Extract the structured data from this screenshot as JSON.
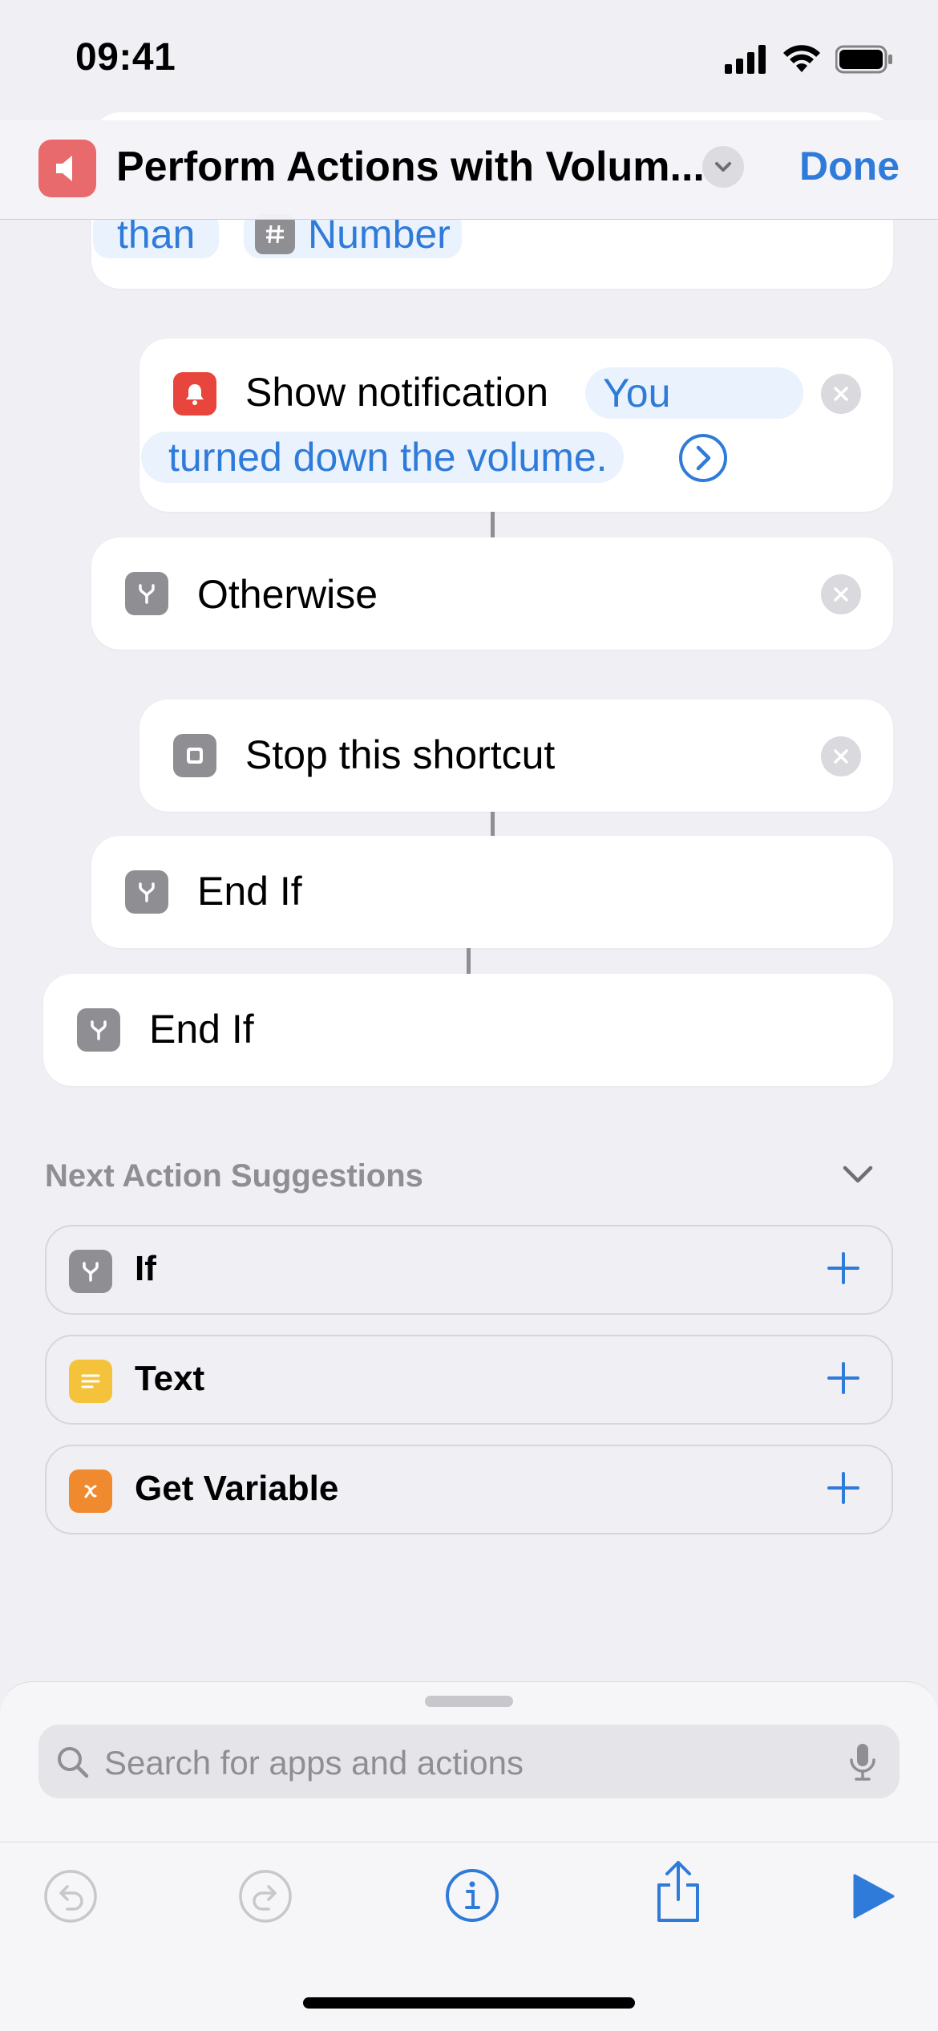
{
  "status_bar": {
    "time": "09:41"
  },
  "navbar": {
    "title": "Perform Actions with Volum...",
    "done_label": "Done",
    "app_icon": "speaker-icon",
    "accent_color": "#2f7bd9",
    "app_icon_color": "#e96a6c"
  },
  "workflow": {
    "partial_card": {
      "token_than": "than",
      "token_number": "Number"
    },
    "show_notification": {
      "label": "Show notification",
      "token_line1": "You",
      "token_line2": "turned down the volume."
    },
    "otherwise": {
      "label": "Otherwise"
    },
    "stop_shortcut": {
      "label": "Stop this shortcut"
    },
    "end_if_inner": {
      "label": "End If"
    },
    "end_if_outer": {
      "label": "End If"
    }
  },
  "suggestions": {
    "header": "Next Action Suggestions",
    "items": [
      {
        "label": "If",
        "icon": "branch-icon",
        "color": "#8e8e93"
      },
      {
        "label": "Text",
        "icon": "text-lines-icon",
        "color": "#f5c33b"
      },
      {
        "label": "Get Variable",
        "icon": "variable-x-icon",
        "color": "#f08a2e"
      }
    ]
  },
  "search": {
    "placeholder": "Search for apps and actions"
  },
  "toolbar": {
    "icons": [
      "undo-icon",
      "redo-icon",
      "info-icon",
      "share-icon",
      "play-icon"
    ]
  }
}
